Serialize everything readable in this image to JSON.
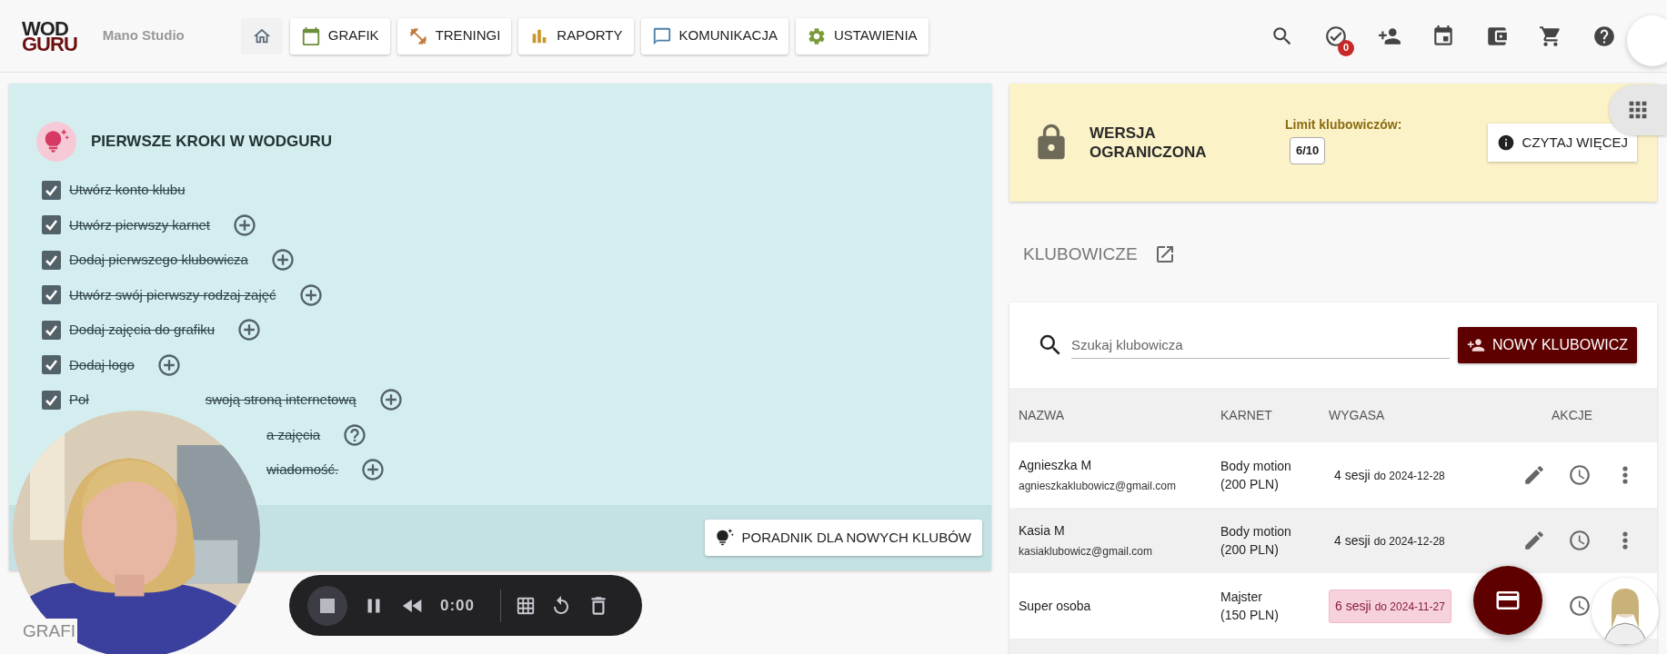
{
  "header": {
    "logo_top": "WOD",
    "logo_bottom": "GURU",
    "studio": "Mano Studio",
    "nav": [
      {
        "kind": "home"
      },
      {
        "kind": "schedule",
        "label": "GRAFIK"
      },
      {
        "kind": "workouts",
        "label": "TRENINGI"
      },
      {
        "kind": "reports",
        "label": "RAPORTY"
      },
      {
        "kind": "messages",
        "label": "KOMUNIKACJA"
      },
      {
        "kind": "settings",
        "label": "USTAWIENIA"
      }
    ],
    "tools": [
      {
        "kind": "search"
      },
      {
        "kind": "tasks",
        "badge": "0"
      },
      {
        "kind": "add_person"
      },
      {
        "kind": "calendar"
      },
      {
        "kind": "wallet"
      },
      {
        "kind": "cart"
      },
      {
        "kind": "help"
      }
    ]
  },
  "onboarding": {
    "title": "PIERWSZE KROKI W WODGURU",
    "steps": [
      {
        "kind": "full",
        "parts": [
          "Utwórz konto klubu"
        ],
        "checked": true
      },
      {
        "kind": "full",
        "parts": [
          "Utwórz pierwszy karnet"
        ],
        "checked": true,
        "button": {
          "kind": "add"
        }
      },
      {
        "kind": "full",
        "parts": [
          "Dodaj pierwszego klubowicza"
        ],
        "checked": true,
        "button": {
          "kind": "add"
        }
      },
      {
        "kind": "full",
        "parts": [
          "Utwórz swój pierwszy rodzaj zajęć"
        ],
        "checked": true,
        "button": {
          "kind": "add"
        }
      },
      {
        "kind": "full",
        "parts": [
          "Dodaj zajęcia do grafiku"
        ],
        "checked": true,
        "button": {
          "kind": "add"
        }
      },
      {
        "kind": "full",
        "parts": [
          "Dodaj logo"
        ],
        "checked": true,
        "button": {
          "kind": "add"
        }
      },
      {
        "kind": "split",
        "parts": [
          "Poł",
          "swoją stroną internetową"
        ],
        "checked": true,
        "button": {
          "kind": "add"
        }
      },
      {
        "kind": "tail",
        "parts": [
          "a zajęcia"
        ],
        "button": {
          "kind": "help"
        }
      },
      {
        "kind": "tail",
        "parts": [
          "wiadomość."
        ],
        "button": {
          "kind": "add"
        }
      }
    ],
    "guide_button": "PORADNIK DLA NOWYCH KLUBÓW"
  },
  "section_below": "GRAFI",
  "recorder": {
    "time": "0:00"
  },
  "plan": {
    "title": "WERSJA OGRANICZONA",
    "limit_label": "Limit klubowiczów:",
    "limit": "6/10",
    "more_button": "CZYTAJ WIĘCEJ"
  },
  "members": {
    "title": "KLUBOWICZE",
    "search": {
      "placeholder": "Szukaj klubowicza"
    },
    "new_button": "NOWY KLUBOWICZ",
    "columns": [
      "NAZWA",
      "KARNET",
      "WYGASA",
      "AKCJE"
    ],
    "rows": [
      {
        "name": "Agnieszka M",
        "email": "agnieszkaklubowicz@gmail.com",
        "pass": [
          "Body motion",
          "(200 PLN)"
        ],
        "sessions": "4 sesji",
        "until": "do 2024-12-28",
        "expiring": false,
        "actions": [
          {
            "kind": "edit"
          },
          {
            "kind": "history"
          },
          {
            "kind": "more"
          }
        ]
      },
      {
        "name": "Kasia M",
        "email": "kasiaklubowicz@gmail.com",
        "pass": [
          "Body motion",
          "(200 PLN)"
        ],
        "sessions": "4 sesji",
        "until": "do 2024-12-28",
        "expiring": false,
        "actions": [
          {
            "kind": "edit"
          },
          {
            "kind": "history"
          },
          {
            "kind": "more"
          }
        ]
      },
      {
        "name": "Super osoba",
        "pass": [
          "Majster",
          "(150 PLN)"
        ],
        "sessions": "6 sesji",
        "until": "do 2024-11-27",
        "expiring": true,
        "actions": [
          {
            "kind": "history"
          }
        ]
      }
    ]
  }
}
